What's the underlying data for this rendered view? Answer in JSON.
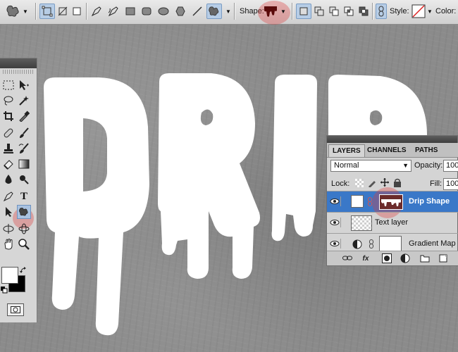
{
  "options_bar": {
    "shape_label": "Shape:",
    "style_label": "Style:",
    "color_label": "Color:"
  },
  "canvas": {
    "text": "DRIP",
    "colors": {
      "text": "#ffffff",
      "background": "#8b8b8b"
    }
  },
  "tools_panel": {
    "type_tool_glyph": "T"
  },
  "layers_panel": {
    "tabs": [
      {
        "label": "LAYERS",
        "active": true
      },
      {
        "label": "CHANNELS",
        "active": false
      },
      {
        "label": "PATHS",
        "active": false
      }
    ],
    "blend_mode": "Normal",
    "opacity_label": "Opacity:",
    "opacity_value": "100",
    "lock_label": "Lock:",
    "fill_label": "Fill:",
    "fill_value": "100",
    "layers": [
      {
        "name": "Drip Shape",
        "selected": true
      },
      {
        "name": "Text layer",
        "selected": false
      },
      {
        "name": "Gradient Map",
        "selected": false
      }
    ],
    "footer_fx": "fx"
  },
  "accent_color": "#3a78c8",
  "highlight_color": "#dc3c3c"
}
